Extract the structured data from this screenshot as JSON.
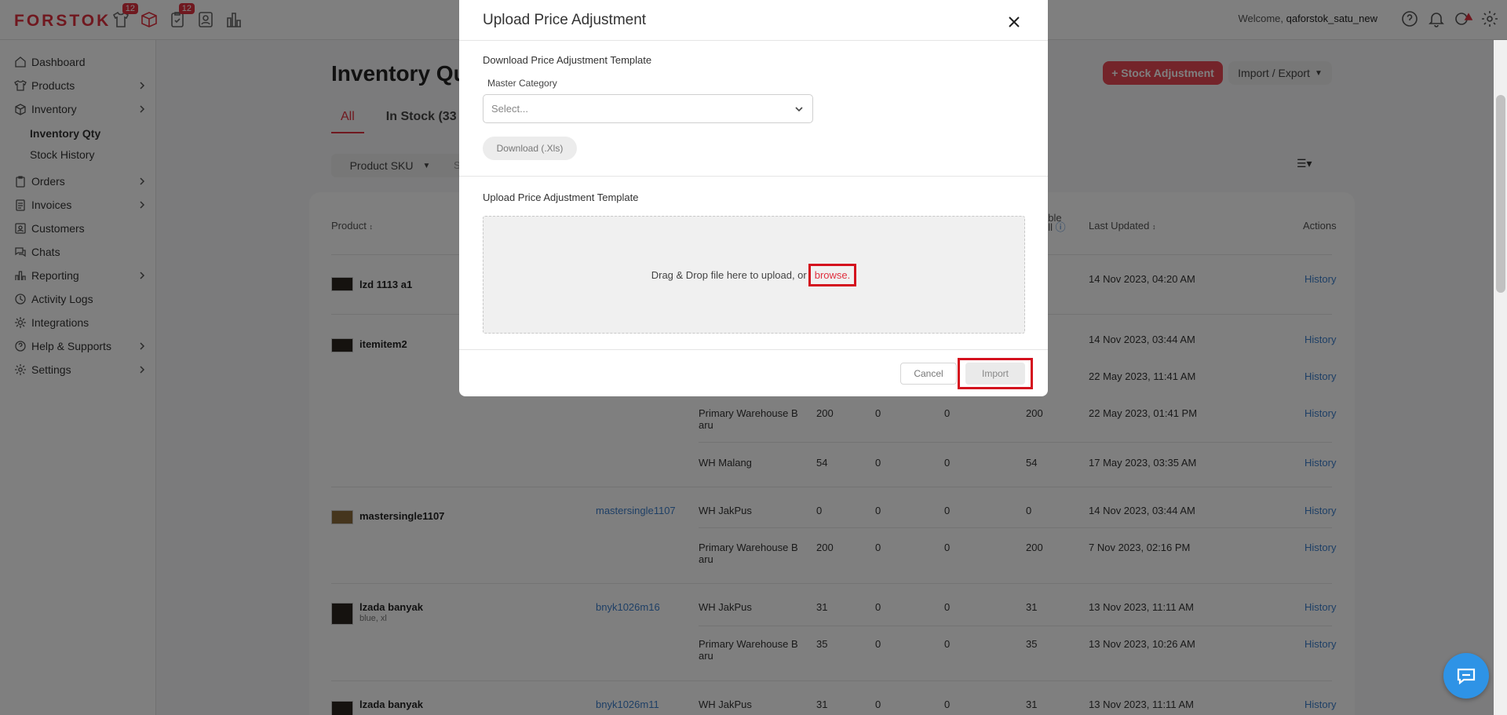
{
  "app": {
    "logo": "FORSTOK"
  },
  "topbar": {
    "badges": [
      "12",
      "12"
    ],
    "welcome_prefix": "Welcome,",
    "username": "qaforstok_satu_new"
  },
  "sidebar": {
    "items": [
      {
        "label": "Dashboard",
        "icon": "home-icon"
      },
      {
        "label": "Products",
        "icon": "shirt-icon"
      },
      {
        "label": "Inventory",
        "icon": "box-icon"
      },
      {
        "label": "Orders",
        "icon": "clipboard-icon"
      },
      {
        "label": "Invoices",
        "icon": "document-icon"
      },
      {
        "label": "Customers",
        "icon": "contact-icon"
      },
      {
        "label": "Chats",
        "icon": "chat-icon"
      },
      {
        "label": "Reporting",
        "icon": "bar-chart-icon"
      },
      {
        "label": "Activity Logs",
        "icon": "history-icon"
      },
      {
        "label": "Integrations",
        "icon": "integration-icon"
      },
      {
        "label": "Help & Supports",
        "icon": "help-icon"
      },
      {
        "label": "Settings",
        "icon": "gear-icon"
      }
    ],
    "sub_items": [
      "Inventory Qty",
      "Stock History"
    ]
  },
  "main": {
    "title": "Inventory Qu",
    "tabs": [
      "All",
      "In Stock (33"
    ],
    "stock_adjustment_btn": "+ Stock Adjustment",
    "import_export_btn": "Import / Export",
    "filter_select": "Product SKU",
    "filter_input_placeholder": "S",
    "table_headers": {
      "product": "Product",
      "available_line1": "able",
      "available_line2": "ell",
      "last_updated": "Last Updated",
      "actions": "Actions"
    },
    "rows": [
      {
        "name": "lzd 1113 a1",
        "variant": "",
        "sku": "",
        "warehouse": "",
        "q1": "",
        "q2": "",
        "q3": "",
        "q4": "",
        "updated": "14 Nov 2023, 04:20 AM"
      },
      {
        "name": "itemitem2",
        "variant": "",
        "sku": "",
        "warehouse": "",
        "q1": "",
        "q2": "",
        "q3": "",
        "q4": "",
        "updated": "14 Nov 2023, 03:44 AM"
      },
      {
        "name": "",
        "variant": "",
        "sku": "",
        "warehouse": "",
        "q1": "",
        "q2": "",
        "q3": "",
        "q4": "",
        "updated": "22 May 2023, 11:41 AM"
      },
      {
        "name": "",
        "variant": "",
        "sku": "",
        "warehouse": "Primary Warehouse B aru",
        "q1": "200",
        "q2": "0",
        "q3": "0",
        "q4": "200",
        "updated": "22 May 2023, 01:41 PM"
      },
      {
        "name": "",
        "variant": "",
        "sku": "",
        "warehouse": "WH Malang",
        "q1": "54",
        "q2": "0",
        "q3": "0",
        "q4": "54",
        "updated": "17 May 2023, 03:35 AM"
      },
      {
        "name": "mastersingle1107",
        "variant": "",
        "sku": "mastersingle1107",
        "warehouse": "WH JakPus",
        "q1": "0",
        "q2": "0",
        "q3": "0",
        "q4": "0",
        "updated": "14 Nov 2023, 03:44 AM"
      },
      {
        "name": "",
        "variant": "",
        "sku": "",
        "warehouse": "Primary Warehouse B aru",
        "q1": "200",
        "q2": "0",
        "q3": "0",
        "q4": "200",
        "updated": "7 Nov 2023, 02:16 PM"
      },
      {
        "name": "lzada banyak",
        "variant": "blue, xl",
        "sku": "bnyk1026m16",
        "warehouse": "WH JakPus",
        "q1": "31",
        "q2": "0",
        "q3": "0",
        "q4": "31",
        "updated": "13 Nov 2023, 11:11 AM"
      },
      {
        "name": "",
        "variant": "",
        "sku": "",
        "warehouse": "Primary Warehouse B aru",
        "q1": "35",
        "q2": "0",
        "q3": "0",
        "q4": "35",
        "updated": "13 Nov 2023, 10:26 AM"
      },
      {
        "name": "lzada banyak",
        "variant": "",
        "sku": "bnyk1026m11",
        "warehouse": "WH JakPus",
        "q1": "31",
        "q2": "0",
        "q3": "0",
        "q4": "31",
        "updated": "13 Nov 2023, 11:11 AM"
      }
    ],
    "history_label": "History"
  },
  "modal": {
    "title": "Upload Price Adjustment",
    "download_section_title": "Download Price Adjustment Template",
    "master_category_label": "Master Category",
    "select_placeholder": "Select...",
    "download_btn": "Download (.Xls)",
    "upload_section_title": "Upload Price Adjustment Template",
    "dropzone_text": "Drag & Drop file here to upload, or",
    "browse_link": "browse.",
    "cancel_btn": "Cancel",
    "import_btn": "Import"
  },
  "colors": {
    "brand": "#e0303f",
    "link": "#3c7fcc",
    "highlight": "#d4101e"
  }
}
